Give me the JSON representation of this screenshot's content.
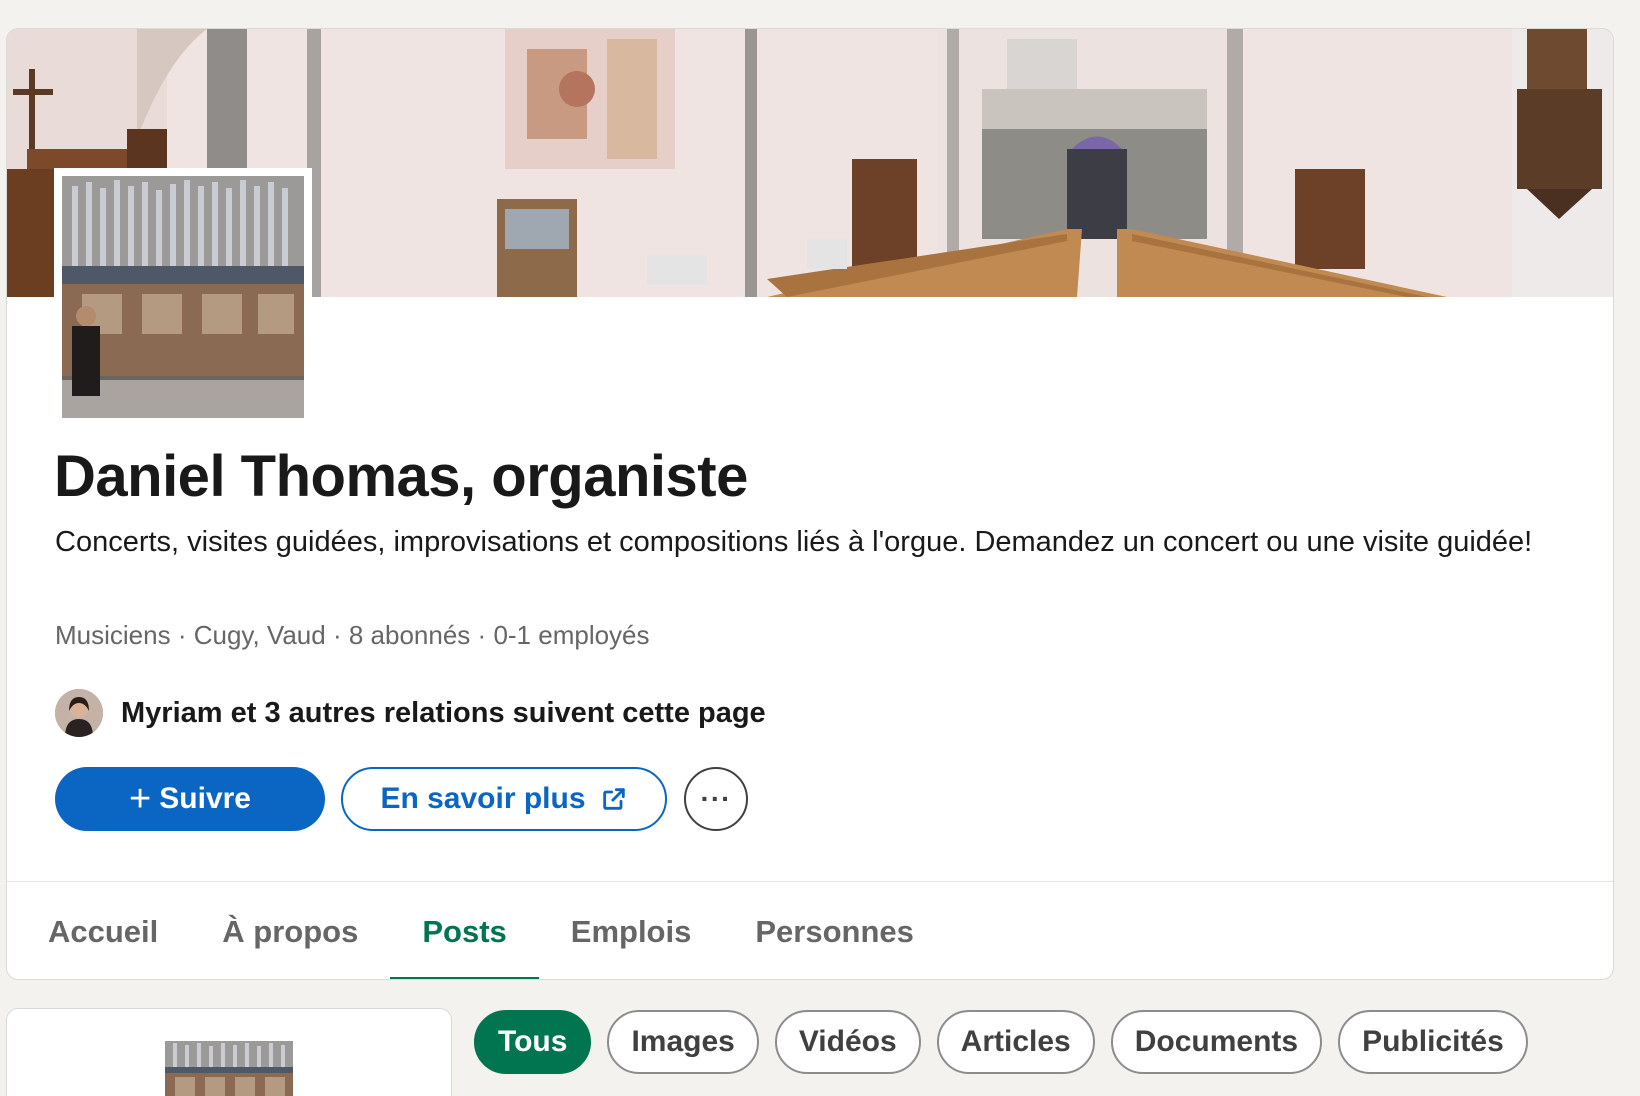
{
  "company": {
    "name": "Daniel Thomas, organiste",
    "tagline": "Concerts, visites guidées, improvisations et compositions liés à l'orgue. Demandez un concert ou une visite guidée!",
    "meta": {
      "industry": "Musiciens",
      "location": "Cugy, Vaud",
      "followers": "8 abonnés",
      "employees": "0-1 employés"
    },
    "followers_note": "Myriam et 3 autres relations suivent cette page"
  },
  "actions": {
    "follow_label": "Suivre",
    "learn_more_label": "En savoir plus",
    "more_label": "···"
  },
  "tabs": [
    {
      "label": "Accueil"
    },
    {
      "label": "À propos"
    },
    {
      "label": "Posts"
    },
    {
      "label": "Emplois"
    },
    {
      "label": "Personnes"
    }
  ],
  "active_tab": "Posts",
  "filters": [
    {
      "label": "Tous"
    },
    {
      "label": "Images"
    },
    {
      "label": "Vidéos"
    },
    {
      "label": "Articles"
    },
    {
      "label": "Documents"
    },
    {
      "label": "Publicités"
    }
  ],
  "active_filter": "Tous",
  "icons": {
    "plus": "plus-icon",
    "external": "external-link-icon",
    "more": "more-horizontal-icon"
  },
  "colors": {
    "primary": "#0a66c2",
    "active_green": "#01754f",
    "muted_text": "#666666",
    "page_background": "#f4f2ee"
  }
}
